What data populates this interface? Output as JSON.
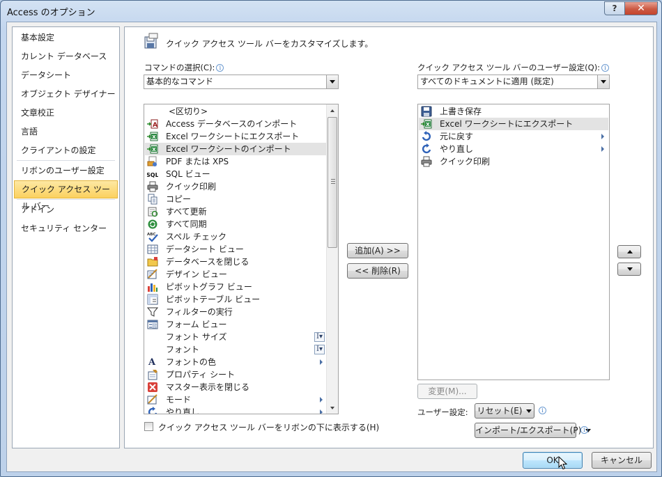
{
  "window": {
    "title": "Access のオプション",
    "help": "?",
    "close": "✕"
  },
  "nav": [
    {
      "label": "基本設定"
    },
    {
      "label": "カレント データベース"
    },
    {
      "label": "データシート"
    },
    {
      "label": "オブジェクト デザイナー"
    },
    {
      "label": "文章校正"
    },
    {
      "label": "言語"
    },
    {
      "label": "クライアントの設定"
    },
    {
      "label": "リボンのユーザー設定"
    },
    {
      "label": "クイック アクセス ツール バー",
      "active": true
    },
    {
      "label": "アドイン"
    },
    {
      "label": "セキュリティ センター"
    }
  ],
  "header": {
    "text": "クイック アクセス ツール バーをカスタマイズします。"
  },
  "commands": {
    "label": "コマンドの選択(C):",
    "selected": "基本的なコマンド",
    "items": [
      {
        "label": "<区切り>",
        "icon": "separator"
      },
      {
        "label": "Access データベースのインポート",
        "icon": "access-import-icon"
      },
      {
        "label": "Excel ワークシートにエクスポート",
        "icon": "excel-export-icon"
      },
      {
        "label": "Excel ワークシートのインポート",
        "icon": "excel-import-icon",
        "selected": true
      },
      {
        "label": "PDF または XPS",
        "icon": "pdf-icon"
      },
      {
        "label": "SQL ビュー",
        "icon": "sql-icon"
      },
      {
        "label": "クイック印刷",
        "icon": "printer-icon"
      },
      {
        "label": "コピー",
        "icon": "copy-icon"
      },
      {
        "label": "すべて更新",
        "icon": "refresh-all-icon"
      },
      {
        "label": "すべて同期",
        "icon": "sync-icon"
      },
      {
        "label": "スペル チェック",
        "icon": "spell-check-icon"
      },
      {
        "label": "データシート ビュー",
        "icon": "datasheet-icon"
      },
      {
        "label": "データベースを閉じる",
        "icon": "close-db-icon"
      },
      {
        "label": "デザイン ビュー",
        "icon": "design-view-icon"
      },
      {
        "label": "ピボットグラフ ビュー",
        "icon": "pivot-chart-icon"
      },
      {
        "label": "ピボットテーブル ビュー",
        "icon": "pivot-table-icon"
      },
      {
        "label": "フィルターの実行",
        "icon": "filter-icon"
      },
      {
        "label": "フォーム ビュー",
        "icon": "form-view-icon"
      },
      {
        "label": "フォント サイズ",
        "icon": "none",
        "extra": "font-drop"
      },
      {
        "label": "フォント",
        "icon": "none",
        "extra": "font-drop"
      },
      {
        "label": "フォントの色",
        "icon": "font-color-icon",
        "extra": "arrow"
      },
      {
        "label": "プロパティ シート",
        "icon": "property-sheet-icon"
      },
      {
        "label": "マスター表示を閉じる",
        "icon": "close-master-icon"
      },
      {
        "label": "モード",
        "icon": "mode-icon",
        "extra": "arrow"
      },
      {
        "label": "やり直し",
        "icon": "redo-icon",
        "extra": "arrow"
      }
    ]
  },
  "qat": {
    "label": "クイック アクセス ツール バーのユーザー設定(Q):",
    "selected": "すべてのドキュメントに適用 (既定)",
    "items": [
      {
        "label": "上書き保存",
        "icon": "save-icon"
      },
      {
        "label": "Excel ワークシートにエクスポート",
        "icon": "excel-export-icon",
        "selected": true
      },
      {
        "label": "元に戻す",
        "icon": "undo-icon",
        "extra": "arrow"
      },
      {
        "label": "やり直し",
        "icon": "redo-icon",
        "extra": "arrow"
      },
      {
        "label": "クイック印刷",
        "icon": "printer-icon"
      }
    ]
  },
  "buttons": {
    "add": "追加(A) >>",
    "remove": "<< 削除(R)",
    "modify": "変更(M)...",
    "reset": "リセット(E)",
    "import_export": "インポート/エクスポート(P)",
    "ok": "OK",
    "cancel": "キャンセル"
  },
  "user_settings_label": "ユーザー設定:",
  "below_ribbon_checkbox": {
    "label": "クイック アクセス ツール バーをリボンの下に表示する(H)",
    "checked": false
  },
  "info_glyph": "i",
  "colors": {
    "nav_active": "#fbd15f",
    "ok_focus": "#3c7fb1"
  }
}
